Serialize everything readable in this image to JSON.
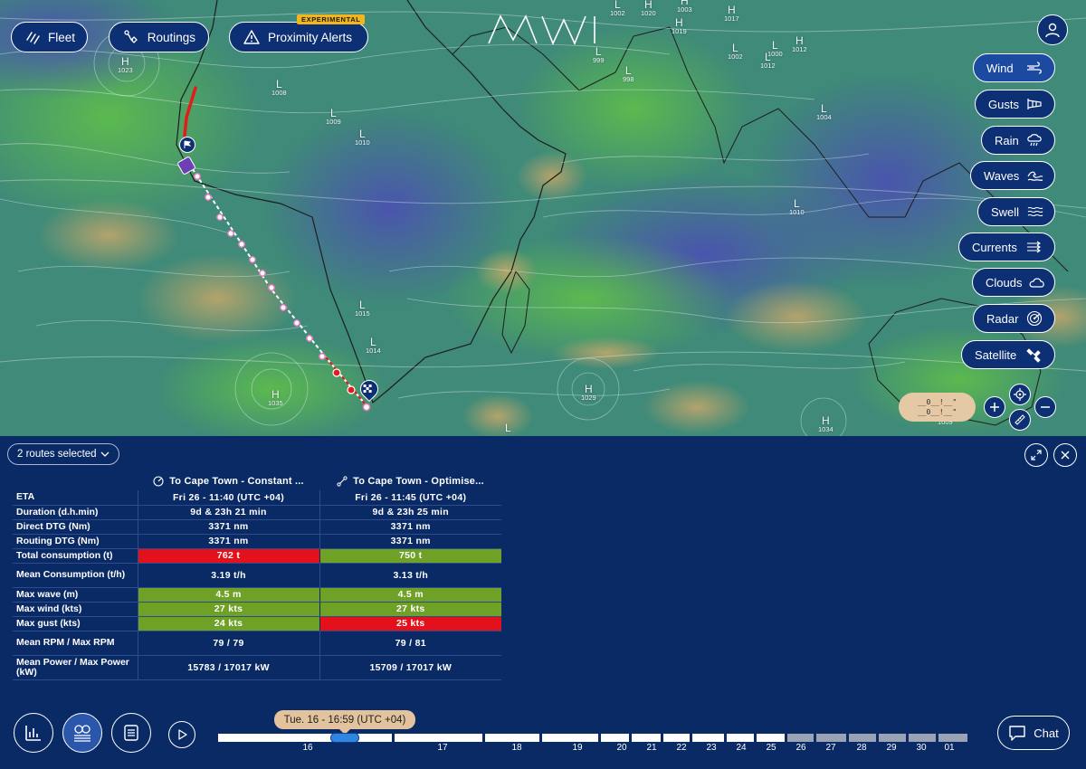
{
  "header": {
    "fleet_label": "Fleet",
    "routings_label": "Routings",
    "proximity_label": "Proximity Alerts",
    "experimental_badge": "EXPERIMENTAL",
    "logo_text": "MWI"
  },
  "layers": [
    {
      "label": "Wind",
      "icon": "wind-icon",
      "active": true
    },
    {
      "label": "Gusts",
      "icon": "windsock-icon"
    },
    {
      "label": "Rain",
      "icon": "rain-cloud-icon"
    },
    {
      "label": "Waves",
      "icon": "waves-icon"
    },
    {
      "label": "Swell",
      "icon": "swell-icon"
    },
    {
      "label": "Currents",
      "icon": "currents-icon"
    },
    {
      "label": "Clouds",
      "icon": "cloud-icon"
    },
    {
      "label": "Radar",
      "icon": "radar-icon"
    },
    {
      "label": "Satellite",
      "icon": "satellite-icon"
    }
  ],
  "pressure_labels": [
    {
      "type": "H",
      "value": "1023"
    },
    {
      "type": "L",
      "value": "1008"
    },
    {
      "type": "L",
      "value": "1009"
    },
    {
      "type": "L",
      "value": "1010"
    },
    {
      "type": "L",
      "value": "1002"
    },
    {
      "type": "H",
      "value": "1020"
    },
    {
      "type": "H",
      "value": "1003"
    },
    {
      "type": "H",
      "value": "1019"
    },
    {
      "type": "H",
      "value": "1017"
    },
    {
      "type": "L",
      "value": "999"
    },
    {
      "type": "L",
      "value": "998"
    },
    {
      "type": "L",
      "value": "1002"
    },
    {
      "type": "L",
      "value": "1012"
    },
    {
      "type": "H",
      "value": "1012"
    },
    {
      "type": "L",
      "value": "1000"
    },
    {
      "type": "L",
      "value": "1004"
    },
    {
      "type": "L",
      "value": "1010"
    },
    {
      "type": "L",
      "value": "1015"
    },
    {
      "type": "L",
      "value": "1014"
    },
    {
      "type": "H",
      "value": "1035"
    },
    {
      "type": "H",
      "value": "1029"
    },
    {
      "type": "H",
      "value": "1034"
    },
    {
      "type": "L",
      "value": ""
    },
    {
      "type": "",
      "value": "1009"
    }
  ],
  "map_scale": {
    "line1": "__0__!__\"",
    "line2": "__0__!__\""
  },
  "panel": {
    "routes_selected": "2 routes selected",
    "columns": [
      {
        "title": "To Cape Town - Constant ...",
        "icon": "speedometer-icon"
      },
      {
        "title": "To Cape Town - Optimise...",
        "icon": "route-icon"
      }
    ],
    "rows": [
      {
        "label": "ETA",
        "values": [
          "Fri 26 - 11:40 (UTC +04)",
          "Fri 26 - 11:45 (UTC +04)"
        ],
        "status": [
          "",
          ""
        ]
      },
      {
        "label": "Duration (d.h.min)",
        "values": [
          "9d & 23h 21 min",
          "9d & 23h 25 min"
        ],
        "status": [
          "",
          ""
        ]
      },
      {
        "label": "Direct DTG (Nm)",
        "values": [
          "3371 nm",
          "3371 nm"
        ],
        "status": [
          "",
          ""
        ]
      },
      {
        "label": "Routing DTG (Nm)",
        "values": [
          "3371 nm",
          "3371 nm"
        ],
        "status": [
          "",
          ""
        ]
      },
      {
        "label": "Total consumption (t)",
        "values": [
          "762 t",
          "750 t"
        ],
        "status": [
          "red",
          "green"
        ]
      },
      {
        "label": "Mean Consumption (t/h)",
        "values": [
          "3.19 t/h",
          "3.13 t/h"
        ],
        "status": [
          "",
          ""
        ],
        "tall": true
      },
      {
        "label": "Max wave (m)",
        "values": [
          "4.5 m",
          "4.5 m"
        ],
        "status": [
          "green",
          "green"
        ]
      },
      {
        "label": "Max wind (kts)",
        "values": [
          "27 kts",
          "27 kts"
        ],
        "status": [
          "green",
          "green"
        ]
      },
      {
        "label": "Max gust (kts)",
        "values": [
          "24 kts",
          "25 kts"
        ],
        "status": [
          "green",
          "red"
        ]
      },
      {
        "label": "Mean RPM / Max RPM",
        "values": [
          "79 / 79",
          "79 / 81"
        ],
        "status": [
          "",
          ""
        ],
        "tall": true
      },
      {
        "label": "Mean Power / Max Power (kW)",
        "values": [
          "15783 / 17017 kW",
          "15709 / 17017 kW"
        ],
        "status": [
          "",
          ""
        ],
        "tall": true
      }
    ]
  },
  "timeline": {
    "tooltip": "Tue. 16 - 16:59 (UTC +04)",
    "days": [
      "16",
      "17",
      "18",
      "19",
      "20",
      "21",
      "22",
      "23",
      "24",
      "25",
      "26",
      "27",
      "28",
      "29",
      "30",
      "01"
    ],
    "current_fraction": 0.16
  },
  "chat_label": "Chat",
  "colors": {
    "panel_bg": "#0a2a66",
    "button_bg": "#0d2f74",
    "red": "#e3111b",
    "green": "#6ea126",
    "tooltip": "#e2c39d"
  }
}
